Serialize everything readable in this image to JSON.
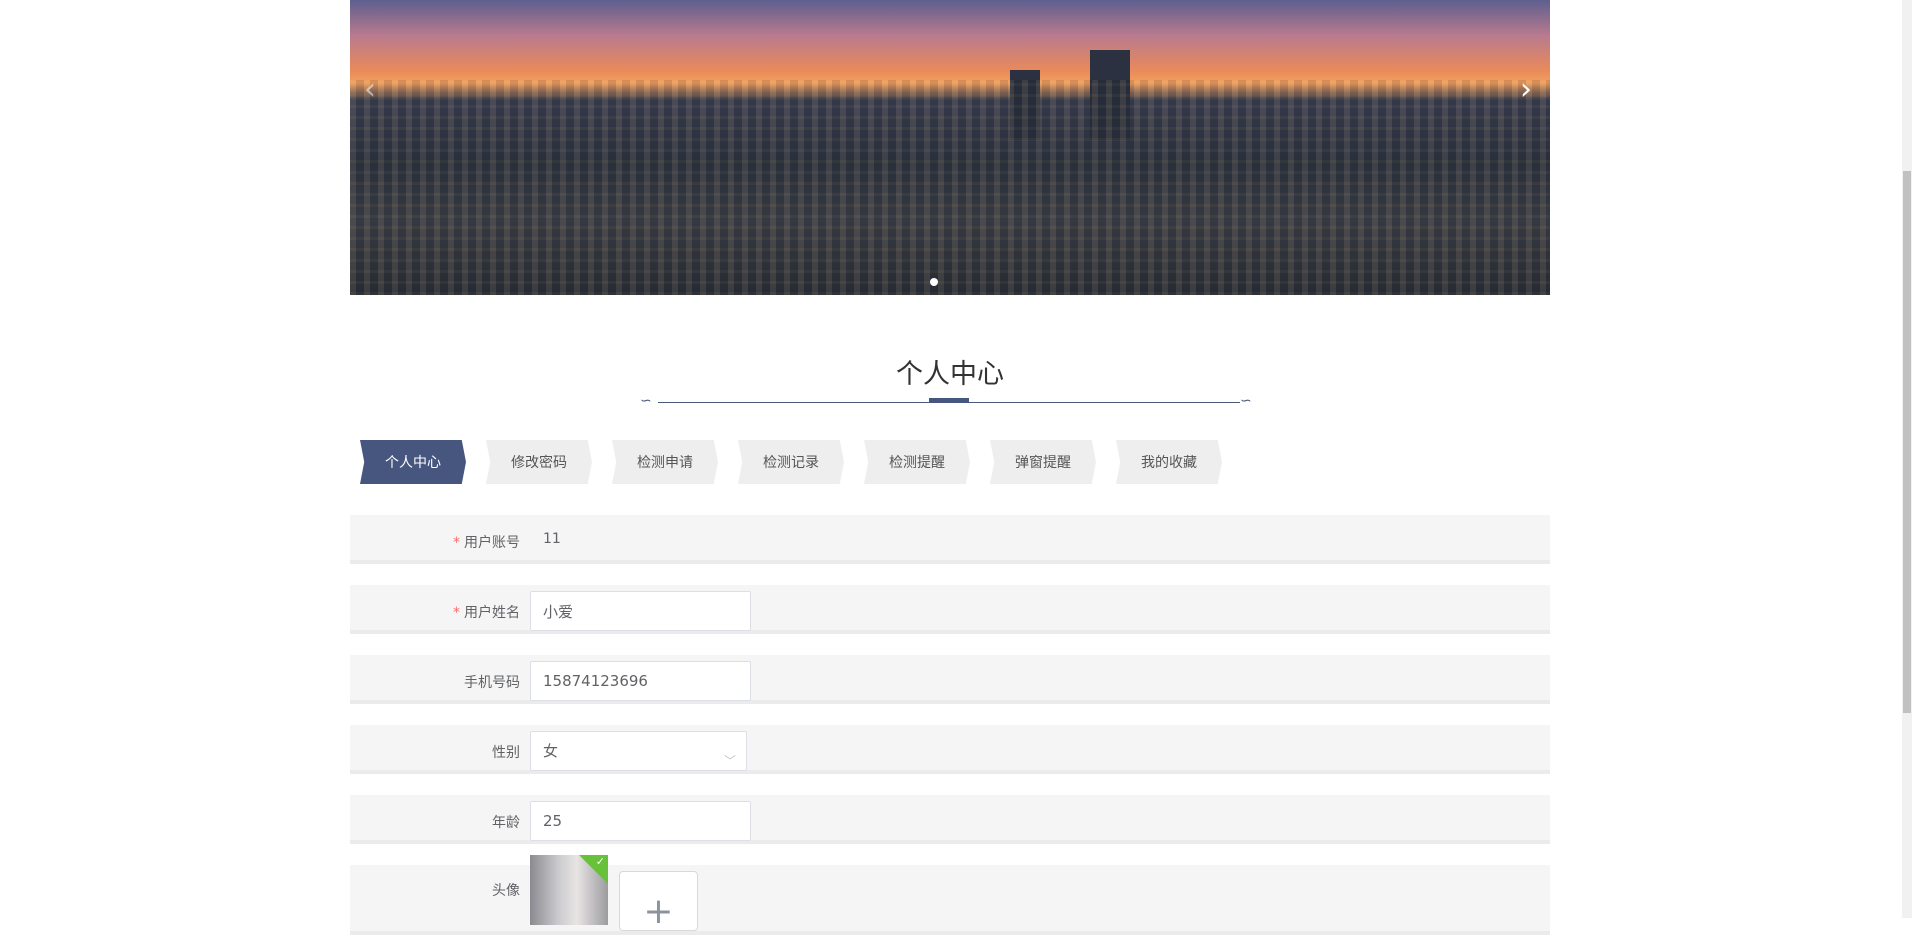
{
  "carousel": {
    "prev_icon": "chevron-left-icon",
    "next_icon": "chevron-right-icon",
    "slide_count": 1,
    "active_slide": 1
  },
  "page_title": "个人中心",
  "tabs": [
    {
      "label": "个人中心",
      "active": true
    },
    {
      "label": "修改密码"
    },
    {
      "label": "检测申请"
    },
    {
      "label": "检测记录"
    },
    {
      "label": "检测提醒"
    },
    {
      "label": "弹窗提醒"
    },
    {
      "label": "我的收藏"
    }
  ],
  "form": {
    "account": {
      "label": "用户账号",
      "required": "*",
      "value": "11"
    },
    "name": {
      "label": "用户姓名",
      "required": "*",
      "value": "小爱"
    },
    "phone": {
      "label": "手机号码",
      "value": "15874123696"
    },
    "gender": {
      "label": "性别",
      "value": "女"
    },
    "age": {
      "label": "年龄",
      "value": "25"
    },
    "avatar": {
      "label": "头像",
      "upload_icon": "plus-icon"
    }
  },
  "colors": {
    "accent": "#47567f",
    "required": "#f56c6c"
  }
}
